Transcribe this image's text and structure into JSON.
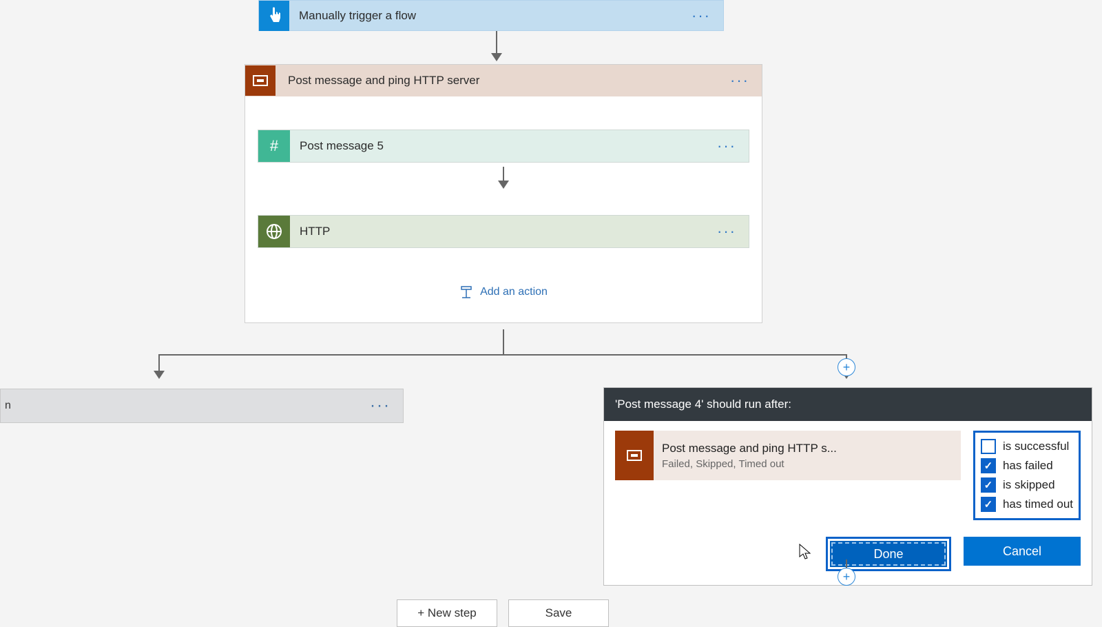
{
  "trigger": {
    "label": "Manually trigger a flow",
    "icon": "tap-icon"
  },
  "scope": {
    "title": "Post message and ping HTTP server",
    "icon": "scope-icon",
    "actions": [
      {
        "label": "Post message 5",
        "icon": "hash-icon",
        "type": "slack"
      },
      {
        "label": "HTTP",
        "icon": "globe-icon",
        "type": "http"
      }
    ],
    "add_action_label": "Add an action"
  },
  "left_branch": {
    "label_tail": "n"
  },
  "run_after_panel": {
    "title": "'Post message 4' should run after:",
    "prev": {
      "title": "Post message and ping HTTP s...",
      "subtitle": "Failed, Skipped, Timed out"
    },
    "conditions": [
      {
        "label": "is successful",
        "checked": false
      },
      {
        "label": "has failed",
        "checked": true
      },
      {
        "label": "is skipped",
        "checked": true
      },
      {
        "label": "has timed out",
        "checked": true
      }
    ],
    "done_label": "Done",
    "cancel_label": "Cancel"
  },
  "footer": {
    "new_step_label": "+ New step",
    "save_label": "Save"
  }
}
